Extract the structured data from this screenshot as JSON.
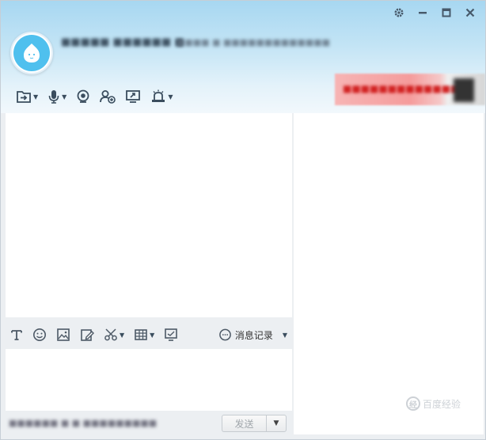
{
  "window": {
    "controls": {
      "settings": "settings-icon",
      "minimize": "minimize-icon",
      "maximize": "maximize-icon",
      "close": "close-icon"
    }
  },
  "contact": {
    "name": "■■■■■ ■■■■■■ ■",
    "signature": "■■■■ ■ ■■■■■■■■■■■■■"
  },
  "ad": {
    "text": "■■■■■■■■■■■■■■"
  },
  "toolbar_top": [
    {
      "icon": "file-transfer-icon",
      "has_menu": true
    },
    {
      "icon": "microphone-icon",
      "has_menu": true
    },
    {
      "icon": "video-camera-icon",
      "has_menu": false
    },
    {
      "icon": "add-contact-icon",
      "has_menu": false
    },
    {
      "icon": "screen-share-icon",
      "has_menu": false
    },
    {
      "icon": "remote-assist-icon",
      "has_menu": true
    }
  ],
  "toolbar_mid": [
    {
      "icon": "font-icon",
      "has_menu": false
    },
    {
      "icon": "emoji-icon",
      "has_menu": false
    },
    {
      "icon": "image-icon",
      "has_menu": false
    },
    {
      "icon": "doodle-icon",
      "has_menu": false
    },
    {
      "icon": "scissors-icon",
      "has_menu": true
    },
    {
      "icon": "table-icon",
      "has_menu": true
    },
    {
      "icon": "screenshot-icon",
      "has_menu": false
    }
  ],
  "history": {
    "label": "消息记录"
  },
  "input": {
    "value": ""
  },
  "footer": {
    "status": "■■■■■■ ■ ■ ■■■■■■■■■"
  },
  "send": {
    "label": "发送"
  },
  "watermark": {
    "text": "百度经验"
  },
  "colors": {
    "avatar": "#4fc0ee",
    "header_top": "#a7d7f1"
  }
}
